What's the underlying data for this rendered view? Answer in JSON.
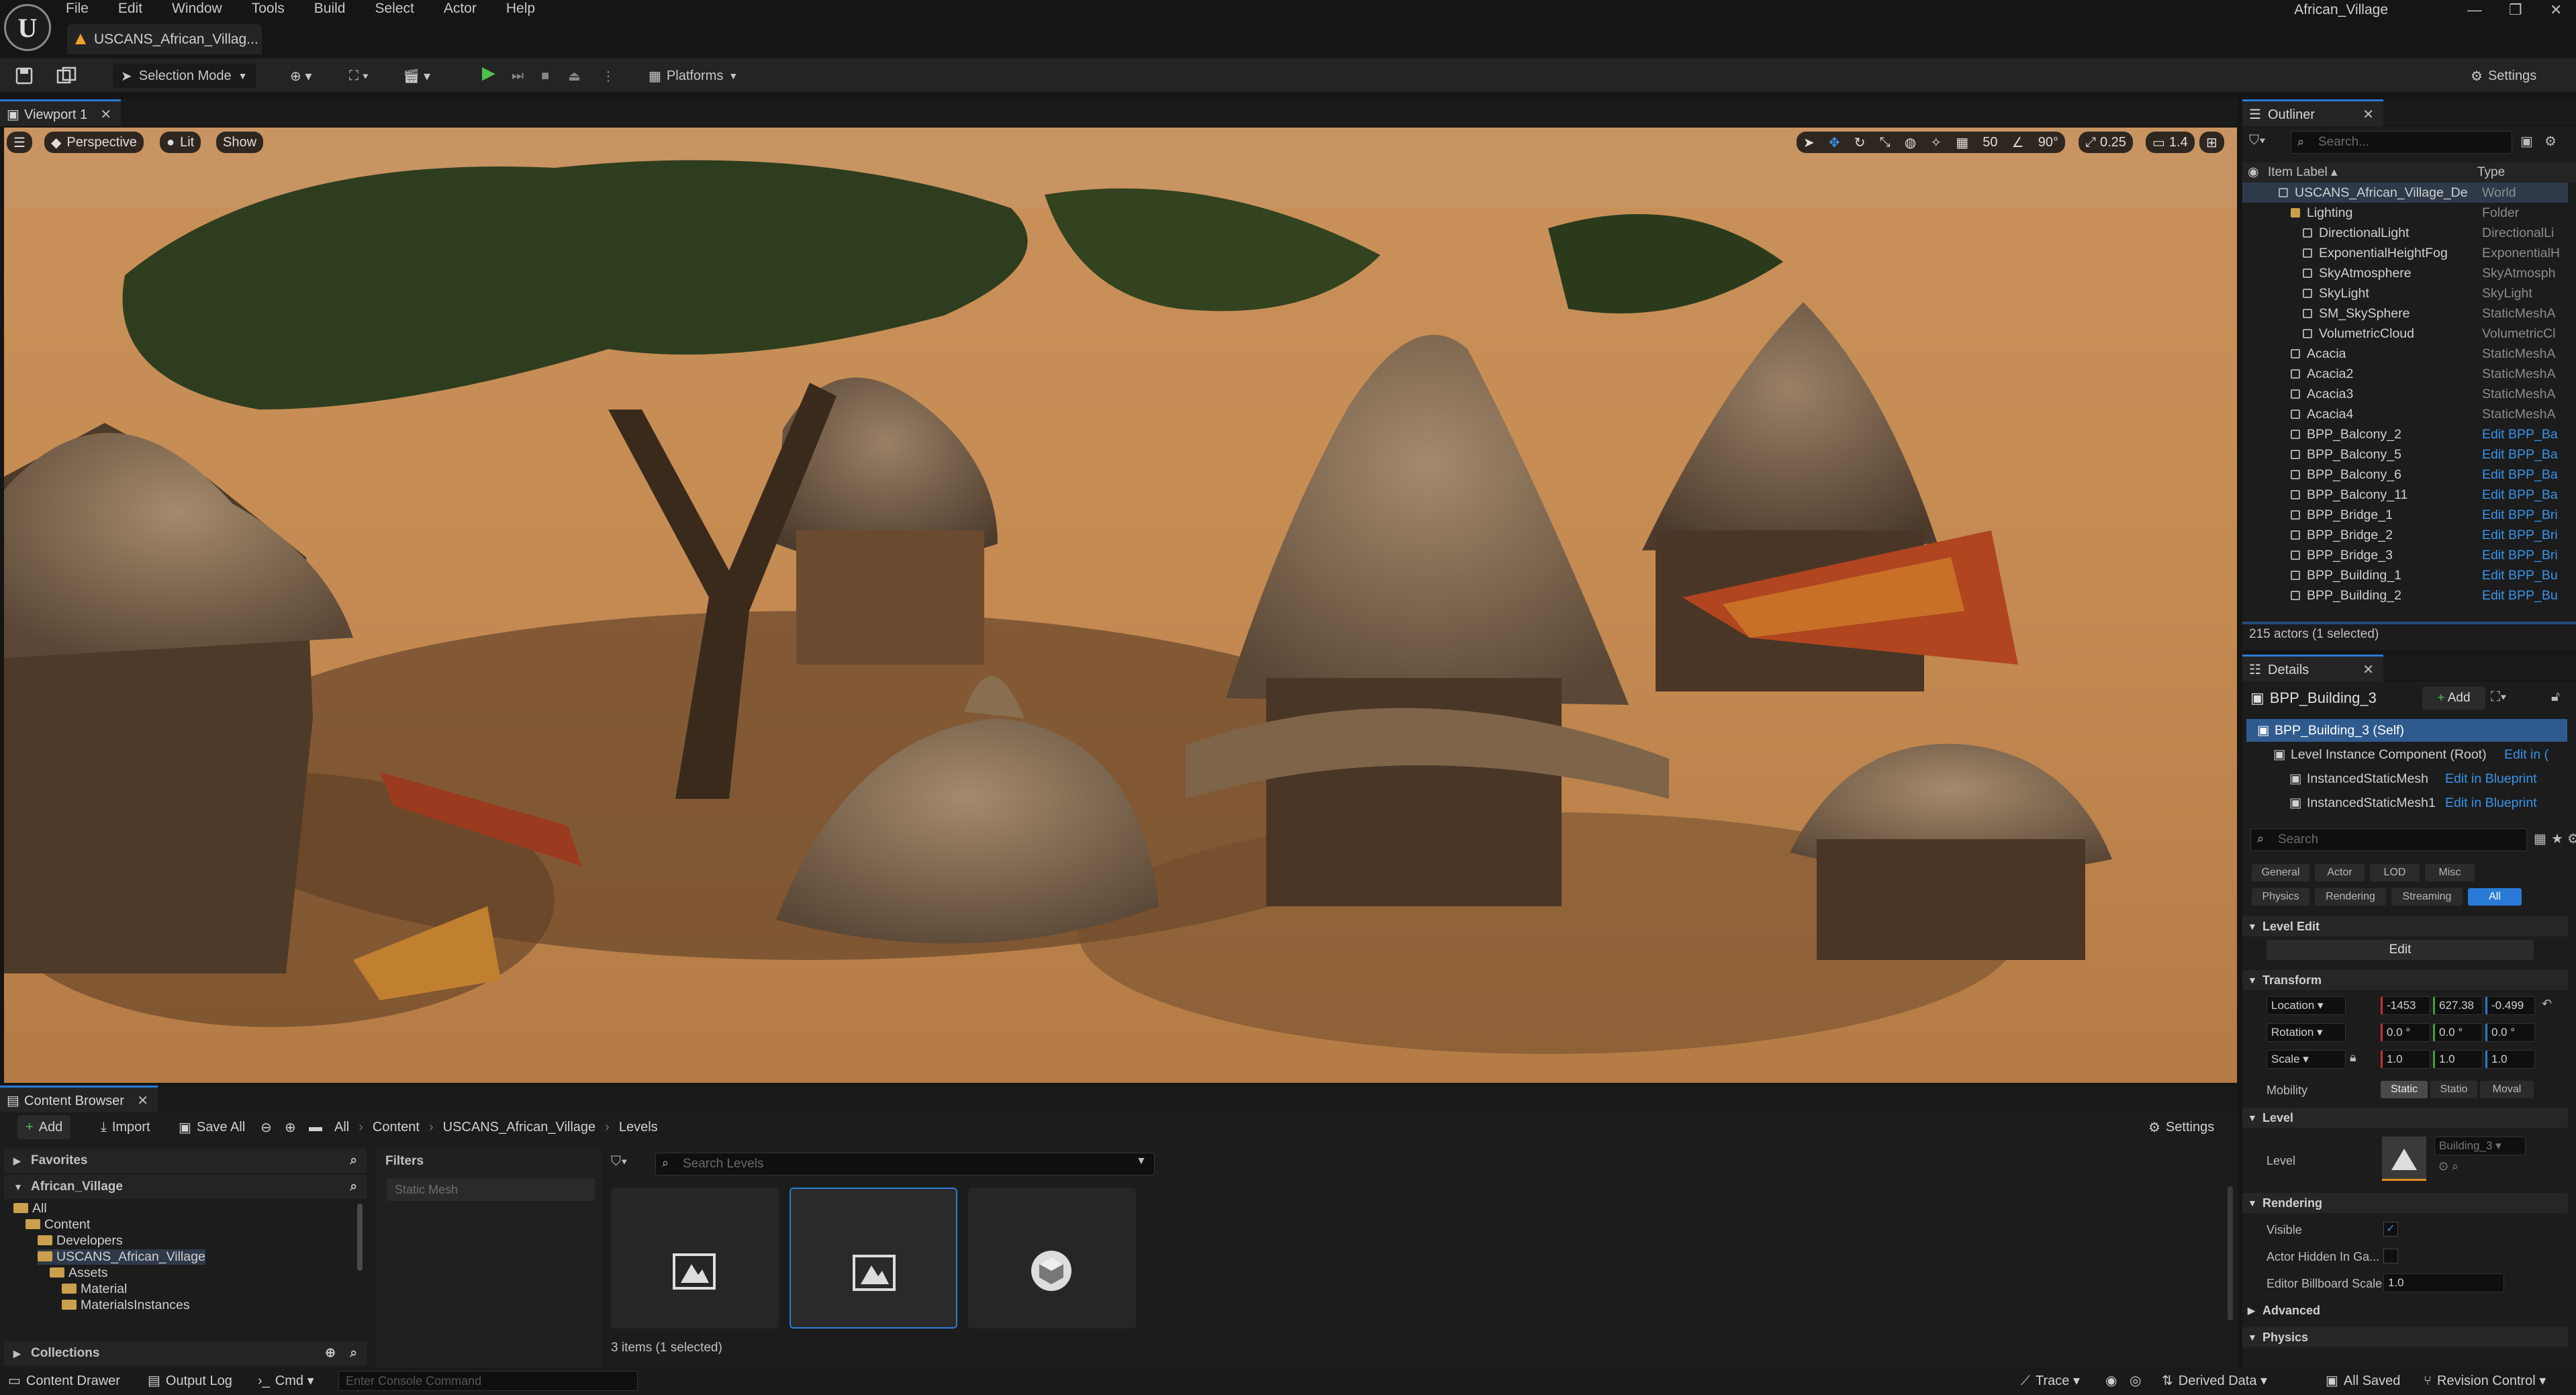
{
  "menu": [
    "File",
    "Edit",
    "Window",
    "Tools",
    "Build",
    "Select",
    "Actor",
    "Help"
  ],
  "document_tab": "USCANS_African_Villag...",
  "project_name": "African_Village",
  "toolbar": {
    "selection_mode": "Selection Mode",
    "platforms": "Platforms",
    "settings": "Settings"
  },
  "viewport": {
    "tab": "Viewport 1",
    "perspective": "Perspective",
    "lit": "Lit",
    "show": "Show",
    "grid": "50",
    "angle": "90°",
    "scale": "0.25",
    "camera_speed": "1.4"
  },
  "outliner": {
    "title": "Outliner",
    "search_placeholder": "Search...",
    "col_label": "Item Label ▴",
    "col_type": "Type",
    "rows": [
      {
        "label": "USCANS_African_Village_De",
        "type": "World",
        "indent": 1
      },
      {
        "label": "Lighting",
        "type": "Folder",
        "indent": 2
      },
      {
        "label": "DirectionalLight",
        "type": "DirectionalLi",
        "indent": 3
      },
      {
        "label": "ExponentialHeightFog",
        "type": "ExponentialH",
        "indent": 3
      },
      {
        "label": "SkyAtmosphere",
        "type": "SkyAtmosph",
        "indent": 3
      },
      {
        "label": "SkyLight",
        "type": "SkyLight",
        "indent": 3
      },
      {
        "label": "SM_SkySphere",
        "type": "StaticMeshA",
        "indent": 3
      },
      {
        "label": "VolumetricCloud",
        "type": "VolumetricCl",
        "indent": 3
      },
      {
        "label": "Acacia",
        "type": "StaticMeshA",
        "indent": 2
      },
      {
        "label": "Acacia2",
        "type": "StaticMeshA",
        "indent": 2
      },
      {
        "label": "Acacia3",
        "type": "StaticMeshA",
        "indent": 2
      },
      {
        "label": "Acacia4",
        "type": "StaticMeshA",
        "indent": 2
      },
      {
        "label": "BPP_Balcony_2",
        "type": "Edit BPP_Ba",
        "indent": 2,
        "link": true
      },
      {
        "label": "BPP_Balcony_5",
        "type": "Edit BPP_Ba",
        "indent": 2,
        "link": true
      },
      {
        "label": "BPP_Balcony_6",
        "type": "Edit BPP_Ba",
        "indent": 2,
        "link": true
      },
      {
        "label": "BPP_Balcony_11",
        "type": "Edit BPP_Ba",
        "indent": 2,
        "link": true
      },
      {
        "label": "BPP_Bridge_1",
        "type": "Edit BPP_Bri",
        "indent": 2,
        "link": true
      },
      {
        "label": "BPP_Bridge_2",
        "type": "Edit BPP_Bri",
        "indent": 2,
        "link": true
      },
      {
        "label": "BPP_Bridge_3",
        "type": "Edit BPP_Bri",
        "indent": 2,
        "link": true
      },
      {
        "label": "BPP_Building_1",
        "type": "Edit BPP_Bu",
        "indent": 2,
        "link": true
      },
      {
        "label": "BPP_Building_2",
        "type": "Edit BPP_Bu",
        "indent": 2,
        "link": true
      }
    ],
    "footer": "215 actors (1 selected)"
  },
  "details": {
    "title": "Details",
    "object": "BPP_Building_3",
    "add": "Add",
    "components": [
      {
        "label": "BPP_Building_3 (Self)",
        "link": ""
      },
      {
        "label": "Level Instance Component (Root)",
        "link": "Edit in ("
      },
      {
        "label": "InstancedStaticMesh",
        "link": "Edit in Blueprint"
      },
      {
        "label": "InstancedStaticMesh1",
        "link": "Edit in Blueprint"
      }
    ],
    "search_placeholder": "Search",
    "filters_row1": [
      "General",
      "Actor",
      "LOD",
      "Misc"
    ],
    "filters_row2": [
      "Physics",
      "Rendering",
      "Streaming",
      "All"
    ],
    "sections": {
      "level_edit": "Level Edit",
      "edit_button": "Edit",
      "transform": "Transform",
      "level": "Level",
      "rendering": "Rendering",
      "advanced": "Advanced",
      "physics": "Physics"
    },
    "transform": {
      "location_label": "Location",
      "location": [
        "-1453",
        "627.38",
        "-0.499"
      ],
      "rotation_label": "Rotation",
      "rotation": [
        "0.0 °",
        "0.0 °",
        "0.0 °"
      ],
      "scale_label": "Scale",
      "scale": [
        "1.0",
        "1.0",
        "1.0"
      ],
      "mobility_label": "Mobility",
      "mobility": [
        "Static",
        "Statio",
        "Moval"
      ]
    },
    "level": {
      "label": "Level",
      "asset": "Building_3"
    },
    "rendering": {
      "visible": "Visible",
      "hidden": "Actor Hidden In Ga...",
      "billboard": "Editor Billboard Scale",
      "billboard_value": "1.0"
    }
  },
  "content_browser": {
    "tab": "Content Browser",
    "add": "Add",
    "import": "Import",
    "save_all": "Save All",
    "breadcrumb": [
      "All",
      "Content",
      "USCANS_African_Village",
      "Levels"
    ],
    "settings": "Settings",
    "favorites": "Favorites",
    "project": "African_Village",
    "tree": [
      {
        "label": "All",
        "indent": 0
      },
      {
        "label": "Content",
        "indent": 1
      },
      {
        "label": "Developers",
        "indent": 2
      },
      {
        "label": "USCANS_African_Village",
        "indent": 2
      },
      {
        "label": "Assets",
        "indent": 3
      },
      {
        "label": "Material",
        "indent": 4
      },
      {
        "label": "MaterialsInstances",
        "indent": 4
      }
    ],
    "collections": "Collections",
    "filters": "Filters",
    "filter_chip": "Static Mesh",
    "search_placeholder": "Search Levels",
    "items_footer": "3 items (1 selected)"
  },
  "statusbar": {
    "content_drawer": "Content Drawer",
    "output_log": "Output Log",
    "cmd": "Cmd",
    "console_placeholder": "Enter Console Command",
    "trace": "Trace",
    "derived_data": "Derived Data",
    "all_saved": "All Saved",
    "revision_control": "Revision Control"
  },
  "colors": {
    "accent": "#2a7bd7",
    "link": "#3a93ea",
    "play": "#4fbf4f"
  }
}
